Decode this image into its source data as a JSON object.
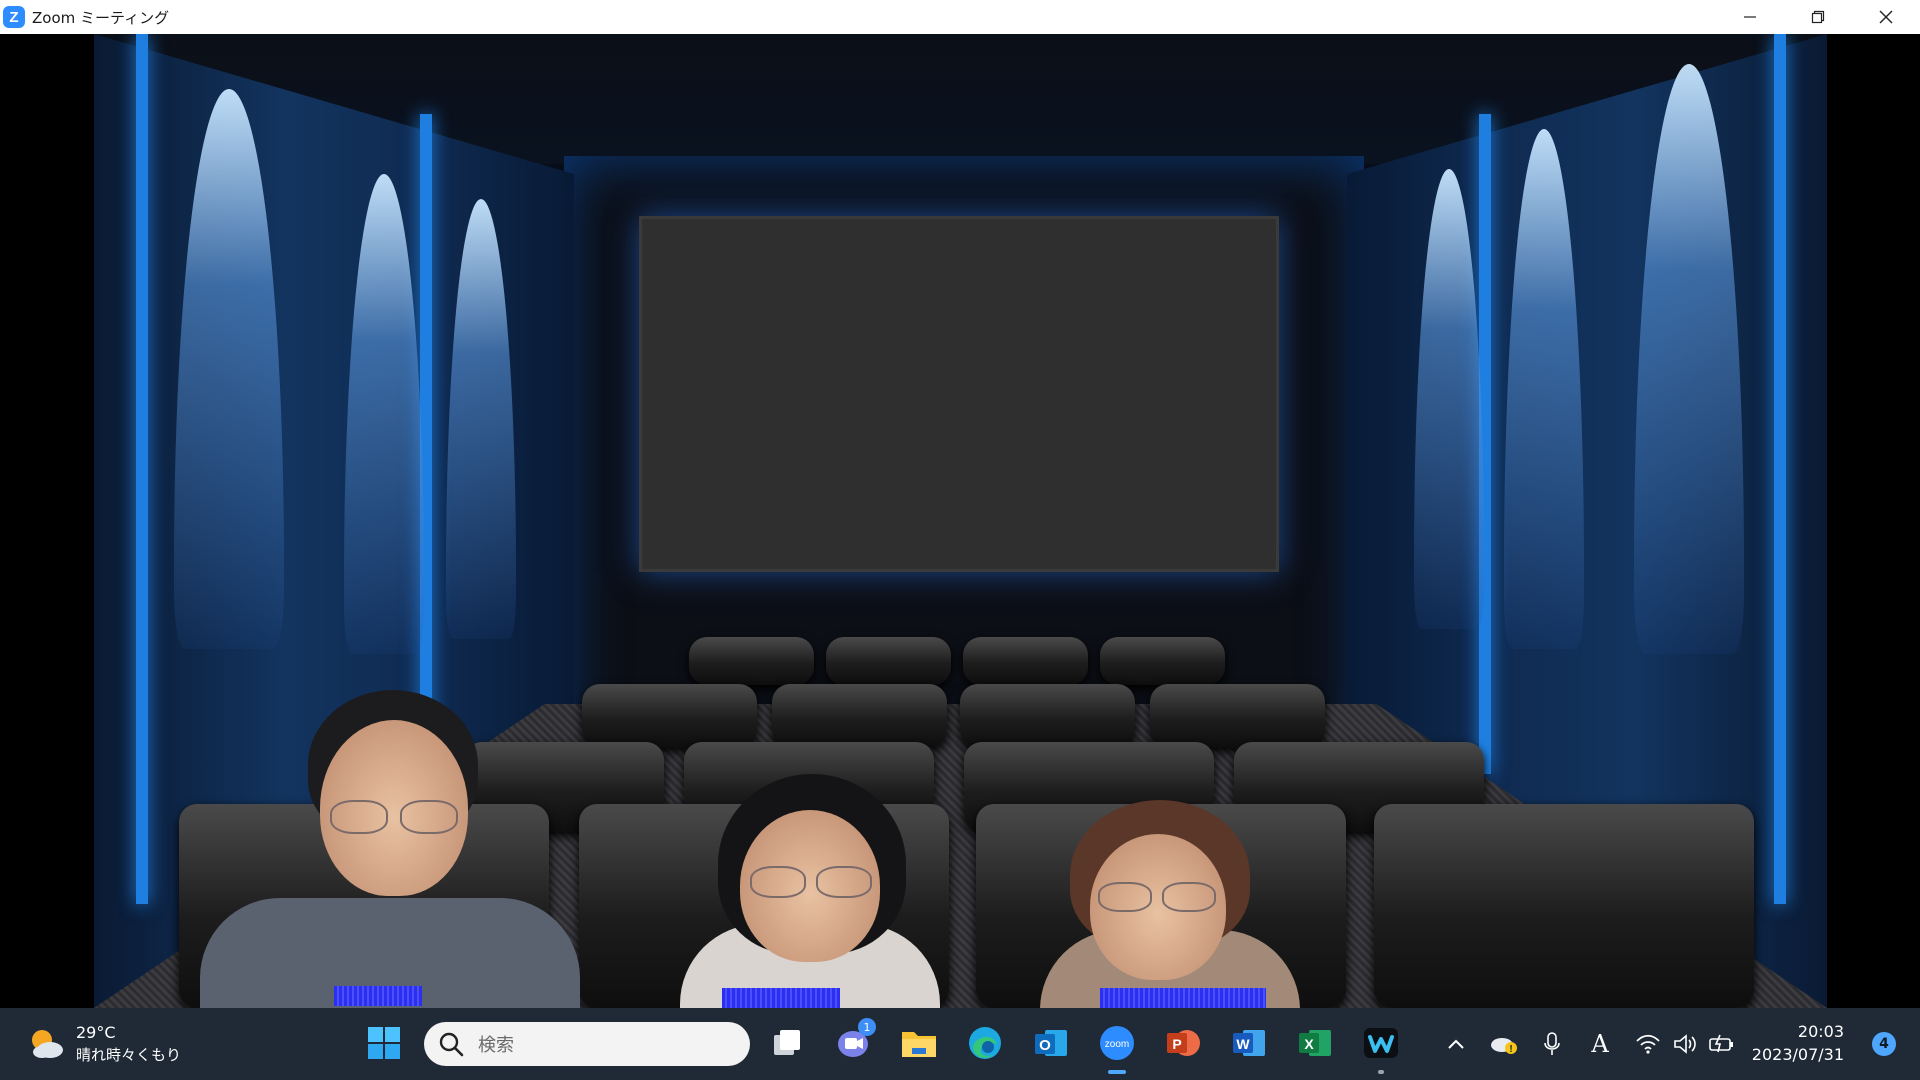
{
  "window": {
    "title": "Zoom ミーティング",
    "app_logo_letter": "Z",
    "controls": [
      "minimize",
      "restore",
      "close"
    ]
  },
  "meeting": {
    "background": "home-theater virtual background",
    "participants_count": 3
  },
  "taskbar": {
    "weather": {
      "temp": "29°C",
      "desc": "晴れ時々くもり"
    },
    "search": {
      "placeholder": "検索"
    },
    "apps": [
      {
        "name": "start",
        "icon": "windows-logo-icon"
      },
      {
        "name": "task-view",
        "icon": "task-view-icon"
      },
      {
        "name": "teams-chat",
        "icon": "teams-chat-icon",
        "badge": "1"
      },
      {
        "name": "file-explorer",
        "icon": "folder-icon"
      },
      {
        "name": "edge",
        "icon": "edge-icon"
      },
      {
        "name": "outlook",
        "icon": "outlook-icon",
        "label": "O"
      },
      {
        "name": "zoom",
        "icon": "zoom-icon",
        "label": "zoom",
        "active": true
      },
      {
        "name": "powerpoint",
        "icon": "powerpoint-icon",
        "label": "P"
      },
      {
        "name": "word",
        "icon": "word-icon",
        "label": "W"
      },
      {
        "name": "excel",
        "icon": "excel-icon",
        "label": "X"
      },
      {
        "name": "webex",
        "icon": "webex-icon"
      }
    ],
    "clock": {
      "time": "20:03",
      "date": "2023/07/31"
    },
    "notification_count": "4",
    "tray": {
      "ime": "A"
    }
  },
  "colors": {
    "accent": "#2d8cff",
    "taskbar": "#1f2a36"
  }
}
